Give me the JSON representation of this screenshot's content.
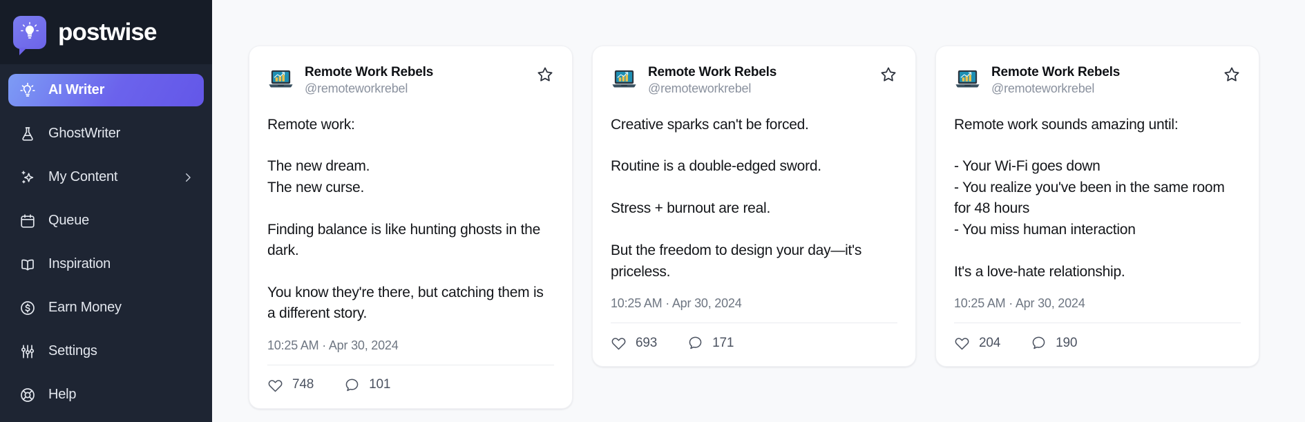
{
  "brand": {
    "name": "postwise",
    "logo_icon": "lightbulb-speech-bubble-icon"
  },
  "sidebar": {
    "items": [
      {
        "label": "AI Writer",
        "icon": "lightbulb-icon",
        "active": true,
        "has_chevron": false
      },
      {
        "label": "GhostWriter",
        "icon": "flask-icon",
        "active": false,
        "has_chevron": false
      },
      {
        "label": "My Content",
        "icon": "sparkles-icon",
        "active": false,
        "has_chevron": true
      },
      {
        "label": "Queue",
        "icon": "calendar-icon",
        "active": false,
        "has_chevron": false
      },
      {
        "label": "Inspiration",
        "icon": "book-icon",
        "active": false,
        "has_chevron": false
      },
      {
        "label": "Earn Money",
        "icon": "dollar-circle-icon",
        "active": false,
        "has_chevron": false
      },
      {
        "label": "Settings",
        "icon": "sliders-icon",
        "active": false,
        "has_chevron": false
      },
      {
        "label": "Help",
        "icon": "lifebuoy-icon",
        "active": false,
        "has_chevron": false
      }
    ]
  },
  "colors": {
    "sidebar_bg": "#1E2533",
    "brand_bg": "#161C27",
    "accent_start": "#7D9CF5",
    "accent_end": "#6357E8",
    "main_bg": "#F8F9FB",
    "card_bg": "#FFFFFF",
    "text_primary": "#14161A",
    "text_muted": "#6E7682"
  },
  "cards": [
    {
      "author_name": "Remote Work Rebels",
      "handle": "@remoteworkrebel",
      "avatar_icon": "laptop-chart-avatar",
      "star_icon": "star-outline-icon",
      "body": "Remote work:\n\nThe new dream.\nThe new curse.\n\nFinding balance is like hunting ghosts in the dark.\n\nYou know they're there, but catching them is a different story.",
      "timestamp": "10:25 AM · Apr 30, 2024",
      "likes": "748",
      "comments": "101"
    },
    {
      "author_name": "Remote Work Rebels",
      "handle": "@remoteworkrebel",
      "avatar_icon": "laptop-chart-avatar",
      "star_icon": "star-outline-icon",
      "body": "Creative sparks can't be forced.\n\nRoutine is a double-edged sword.\n\nStress + burnout are real.\n\nBut the freedom to design your day—it's priceless.",
      "timestamp": "10:25 AM · Apr 30, 2024",
      "likes": "693",
      "comments": "171"
    },
    {
      "author_name": "Remote Work Rebels",
      "handle": "@remoteworkrebel",
      "avatar_icon": "laptop-chart-avatar",
      "star_icon": "star-outline-icon",
      "body": "Remote work sounds amazing until:\n\n- Your Wi-Fi goes down\n- You realize you've been in the same room for 48 hours\n- You miss human interaction\n\nIt's a love-hate relationship.",
      "timestamp": "10:25 AM · Apr 30, 2024",
      "likes": "204",
      "comments": "190"
    }
  ]
}
